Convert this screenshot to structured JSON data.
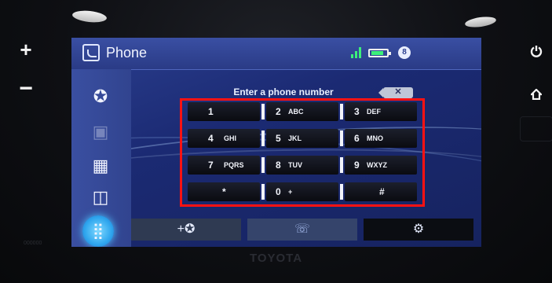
{
  "device": {
    "brand": "TOYOTA",
    "serial": "000000",
    "hardware_buttons": {
      "volume_up": "+",
      "volume_down": "−",
      "power_icon": "power-icon",
      "home_icon": "home-icon"
    }
  },
  "status_bar": {
    "title": "Phone",
    "app_icon": "phone-app-icon",
    "signal_icon": "signal-icon",
    "battery_icon": "battery-icon",
    "bluetooth_icon": "bluetooth-icon",
    "bluetooth_glyph": "8"
  },
  "sidebar": {
    "items": [
      {
        "name": "favorites",
        "icon": "star-icon",
        "glyph": "✪"
      },
      {
        "name": "disabled",
        "icon": "blank-icon",
        "glyph": "▣"
      },
      {
        "name": "contacts",
        "icon": "contacts-icon",
        "glyph": "▦"
      },
      {
        "name": "history",
        "icon": "recent-calls-icon",
        "glyph": "◫"
      },
      {
        "name": "keypad",
        "icon": "keypad-icon",
        "glyph": "⣿"
      }
    ]
  },
  "dialer": {
    "prompt": "Enter a phone number",
    "delete_icon": "backspace-icon",
    "delete_glyph": "✕",
    "keys": [
      {
        "digit": "1",
        "letters": ""
      },
      {
        "digit": "2",
        "letters": "ABC"
      },
      {
        "digit": "3",
        "letters": "DEF"
      },
      {
        "digit": "4",
        "letters": "GHI"
      },
      {
        "digit": "5",
        "letters": "JKL"
      },
      {
        "digit": "6",
        "letters": "MNO"
      },
      {
        "digit": "7",
        "letters": "PQRS"
      },
      {
        "digit": "8",
        "letters": "TUV"
      },
      {
        "digit": "9",
        "letters": "WXYZ"
      },
      {
        "digit": "*",
        "letters": ""
      },
      {
        "digit": "0",
        "letters": "+"
      },
      {
        "digit": "#",
        "letters": ""
      }
    ]
  },
  "bottom_bar": {
    "add_favorite_icon": "add-favorite-icon",
    "add_favorite_glyph": "+✪",
    "call_icon": "call-icon",
    "call_glyph": "☏",
    "settings_icon": "settings-icon",
    "settings_glyph": "⚙"
  },
  "colors": {
    "highlight": "#ff1212",
    "screen": "#1b2a73",
    "keypad_active": "#2fa6ee",
    "signal": "#3cf07a"
  }
}
